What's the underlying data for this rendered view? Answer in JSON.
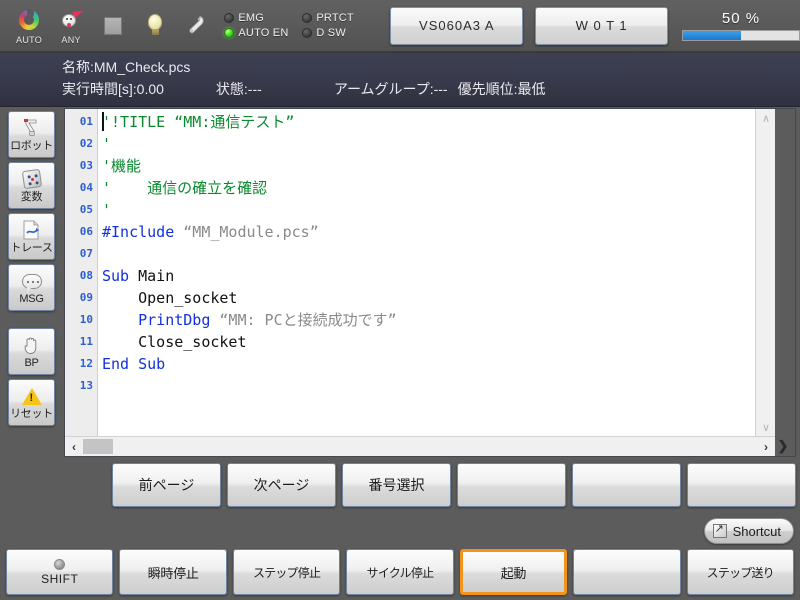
{
  "toolbar": {
    "icons": [
      {
        "name": "auto-mode-icon",
        "caption": "AUTO"
      },
      {
        "name": "any-mode-icon",
        "caption": "ANY"
      },
      {
        "name": "stop-square-icon",
        "caption": ""
      },
      {
        "name": "lamp-icon",
        "caption": ""
      },
      {
        "name": "wrench-icon",
        "caption": ""
      }
    ],
    "leds": [
      {
        "label": "EMG",
        "on": false
      },
      {
        "label": "PRTCT",
        "on": false
      },
      {
        "label": "AUTO EN",
        "on": true
      },
      {
        "label": "D SW",
        "on": false
      }
    ],
    "model_button": "VS060A3 A",
    "tool_button": "W 0 T 1",
    "speed_label": "50 %",
    "speed_percent": 50,
    "accent_blue": "#1879cf"
  },
  "header": {
    "name_label": "名称:MM_Check.pcs",
    "exec_time": "実行時間[s]:0.00",
    "state": "状態:---",
    "arm_group": "アームグループ:---",
    "priority": "優先順位:最低"
  },
  "sidebar": {
    "items": [
      {
        "label": "ロボット",
        "icon": "robot-icon"
      },
      {
        "label": "変数",
        "icon": "variable-dice-icon"
      },
      {
        "label": "トレース",
        "icon": "trace-icon"
      },
      {
        "label": "MSG",
        "icon": "message-bubble-icon"
      },
      {
        "label": "BP",
        "icon": "hand-breakpoint-icon"
      },
      {
        "label": "リセット",
        "icon": "warning-triangle-icon"
      }
    ]
  },
  "editor": {
    "line_numbers": [
      "01",
      "02",
      "03",
      "04",
      "05",
      "06",
      "07",
      "08",
      "09",
      "10",
      "11",
      "12",
      "13"
    ],
    "lines": [
      [
        {
          "t": "'!TITLE “MM:通信テスト”",
          "c": "tok-cmt"
        }
      ],
      [
        {
          "t": "'",
          "c": "tok-cmt"
        }
      ],
      [
        {
          "t": "'機能",
          "c": "tok-cmt"
        }
      ],
      [
        {
          "t": "'    通信の確立を確認",
          "c": "tok-cmt"
        }
      ],
      [
        {
          "t": "'",
          "c": "tok-cmt"
        }
      ],
      [
        {
          "t": "#Include ",
          "c": "tok-pp"
        },
        {
          "t": "“MM_Module.pcs”",
          "c": "tok-str"
        }
      ],
      [
        {
          "t": "",
          "c": "tok-pln"
        }
      ],
      [
        {
          "t": "Sub ",
          "c": "tok-kw"
        },
        {
          "t": "Main",
          "c": "tok-pln"
        }
      ],
      [
        {
          "t": "    Open_socket",
          "c": "tok-pln"
        }
      ],
      [
        {
          "t": "    ",
          "c": "tok-pln"
        },
        {
          "t": "PrintDbg ",
          "c": "tok-kw"
        },
        {
          "t": "“MM: PCと接続成功です”",
          "c": "tok-str"
        }
      ],
      [
        {
          "t": "    Close_socket",
          "c": "tok-pln"
        }
      ],
      [
        {
          "t": "End Sub",
          "c": "tok-kw"
        }
      ],
      [
        {
          "t": "",
          "c": "tok-pln"
        }
      ]
    ],
    "vscroll_up": "∧",
    "vscroll_down": "∨",
    "hscroll_left": "‹",
    "hscroll_right": "›",
    "corner_arrow": "❯"
  },
  "function_row": {
    "buttons": [
      "前ページ",
      "次ページ",
      "番号選択",
      "",
      "",
      ""
    ]
  },
  "shortcut": {
    "label": "Shortcut",
    "icon": "shortcut-arrow-icon"
  },
  "bottom_row": {
    "buttons": [
      {
        "label": "SHIFT",
        "style": "shift",
        "selected": false
      },
      {
        "label": "瞬時停止",
        "style": "normal",
        "selected": false
      },
      {
        "label": "ステップ停止",
        "style": "small",
        "selected": false
      },
      {
        "label": "サイクル停止",
        "style": "small",
        "selected": false
      },
      {
        "label": "起動",
        "style": "normal",
        "selected": true
      },
      {
        "label": "",
        "style": "normal",
        "selected": false
      },
      {
        "label": "ステップ送り",
        "style": "small",
        "selected": false
      }
    ],
    "selected_color": "#f0941e"
  }
}
